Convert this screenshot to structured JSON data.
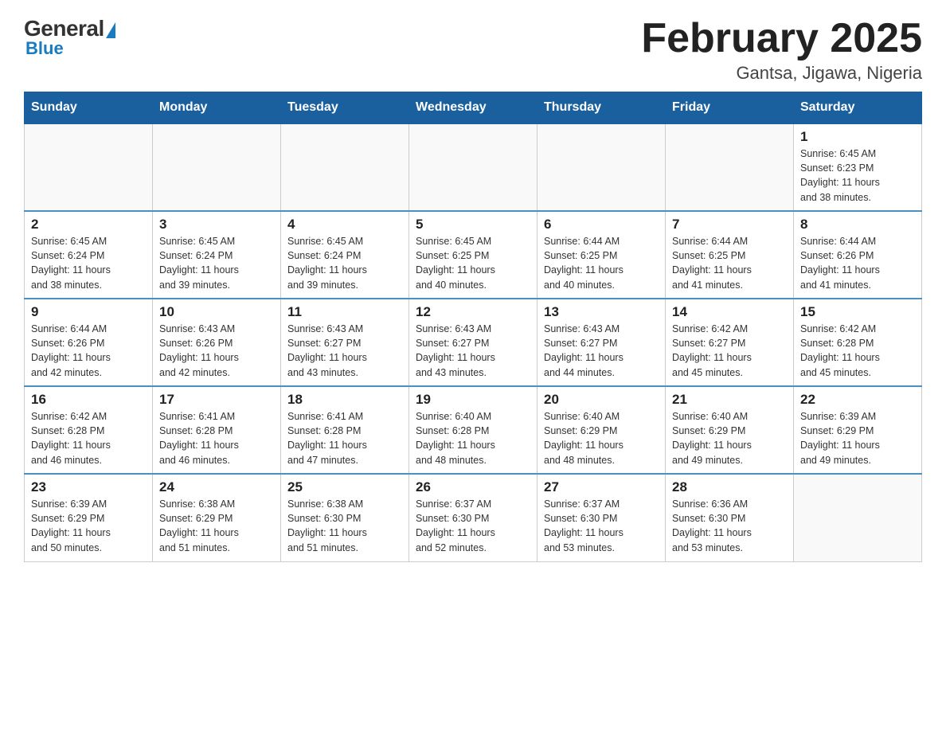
{
  "header": {
    "logo_general": "General",
    "logo_blue": "Blue",
    "month_title": "February 2025",
    "location": "Gantsa, Jigawa, Nigeria"
  },
  "days_of_week": [
    "Sunday",
    "Monday",
    "Tuesday",
    "Wednesday",
    "Thursday",
    "Friday",
    "Saturday"
  ],
  "weeks": [
    [
      {
        "day": "",
        "info": ""
      },
      {
        "day": "",
        "info": ""
      },
      {
        "day": "",
        "info": ""
      },
      {
        "day": "",
        "info": ""
      },
      {
        "day": "",
        "info": ""
      },
      {
        "day": "",
        "info": ""
      },
      {
        "day": "1",
        "info": "Sunrise: 6:45 AM\nSunset: 6:23 PM\nDaylight: 11 hours\nand 38 minutes."
      }
    ],
    [
      {
        "day": "2",
        "info": "Sunrise: 6:45 AM\nSunset: 6:24 PM\nDaylight: 11 hours\nand 38 minutes."
      },
      {
        "day": "3",
        "info": "Sunrise: 6:45 AM\nSunset: 6:24 PM\nDaylight: 11 hours\nand 39 minutes."
      },
      {
        "day": "4",
        "info": "Sunrise: 6:45 AM\nSunset: 6:24 PM\nDaylight: 11 hours\nand 39 minutes."
      },
      {
        "day": "5",
        "info": "Sunrise: 6:45 AM\nSunset: 6:25 PM\nDaylight: 11 hours\nand 40 minutes."
      },
      {
        "day": "6",
        "info": "Sunrise: 6:44 AM\nSunset: 6:25 PM\nDaylight: 11 hours\nand 40 minutes."
      },
      {
        "day": "7",
        "info": "Sunrise: 6:44 AM\nSunset: 6:25 PM\nDaylight: 11 hours\nand 41 minutes."
      },
      {
        "day": "8",
        "info": "Sunrise: 6:44 AM\nSunset: 6:26 PM\nDaylight: 11 hours\nand 41 minutes."
      }
    ],
    [
      {
        "day": "9",
        "info": "Sunrise: 6:44 AM\nSunset: 6:26 PM\nDaylight: 11 hours\nand 42 minutes."
      },
      {
        "day": "10",
        "info": "Sunrise: 6:43 AM\nSunset: 6:26 PM\nDaylight: 11 hours\nand 42 minutes."
      },
      {
        "day": "11",
        "info": "Sunrise: 6:43 AM\nSunset: 6:27 PM\nDaylight: 11 hours\nand 43 minutes."
      },
      {
        "day": "12",
        "info": "Sunrise: 6:43 AM\nSunset: 6:27 PM\nDaylight: 11 hours\nand 43 minutes."
      },
      {
        "day": "13",
        "info": "Sunrise: 6:43 AM\nSunset: 6:27 PM\nDaylight: 11 hours\nand 44 minutes."
      },
      {
        "day": "14",
        "info": "Sunrise: 6:42 AM\nSunset: 6:27 PM\nDaylight: 11 hours\nand 45 minutes."
      },
      {
        "day": "15",
        "info": "Sunrise: 6:42 AM\nSunset: 6:28 PM\nDaylight: 11 hours\nand 45 minutes."
      }
    ],
    [
      {
        "day": "16",
        "info": "Sunrise: 6:42 AM\nSunset: 6:28 PM\nDaylight: 11 hours\nand 46 minutes."
      },
      {
        "day": "17",
        "info": "Sunrise: 6:41 AM\nSunset: 6:28 PM\nDaylight: 11 hours\nand 46 minutes."
      },
      {
        "day": "18",
        "info": "Sunrise: 6:41 AM\nSunset: 6:28 PM\nDaylight: 11 hours\nand 47 minutes."
      },
      {
        "day": "19",
        "info": "Sunrise: 6:40 AM\nSunset: 6:28 PM\nDaylight: 11 hours\nand 48 minutes."
      },
      {
        "day": "20",
        "info": "Sunrise: 6:40 AM\nSunset: 6:29 PM\nDaylight: 11 hours\nand 48 minutes."
      },
      {
        "day": "21",
        "info": "Sunrise: 6:40 AM\nSunset: 6:29 PM\nDaylight: 11 hours\nand 49 minutes."
      },
      {
        "day": "22",
        "info": "Sunrise: 6:39 AM\nSunset: 6:29 PM\nDaylight: 11 hours\nand 49 minutes."
      }
    ],
    [
      {
        "day": "23",
        "info": "Sunrise: 6:39 AM\nSunset: 6:29 PM\nDaylight: 11 hours\nand 50 minutes."
      },
      {
        "day": "24",
        "info": "Sunrise: 6:38 AM\nSunset: 6:29 PM\nDaylight: 11 hours\nand 51 minutes."
      },
      {
        "day": "25",
        "info": "Sunrise: 6:38 AM\nSunset: 6:30 PM\nDaylight: 11 hours\nand 51 minutes."
      },
      {
        "day": "26",
        "info": "Sunrise: 6:37 AM\nSunset: 6:30 PM\nDaylight: 11 hours\nand 52 minutes."
      },
      {
        "day": "27",
        "info": "Sunrise: 6:37 AM\nSunset: 6:30 PM\nDaylight: 11 hours\nand 53 minutes."
      },
      {
        "day": "28",
        "info": "Sunrise: 6:36 AM\nSunset: 6:30 PM\nDaylight: 11 hours\nand 53 minutes."
      },
      {
        "day": "",
        "info": ""
      }
    ]
  ]
}
